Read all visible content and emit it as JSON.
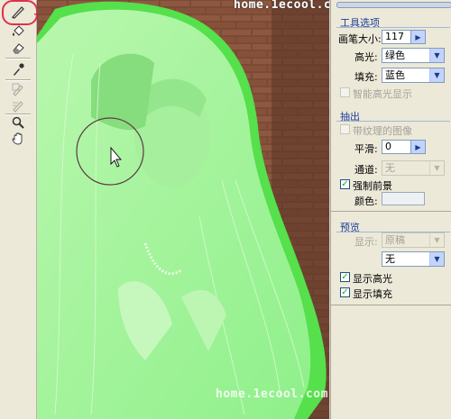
{
  "watermark": "home.1ecool.com",
  "tools": [
    {
      "name": "edge-highlighter-tool-icon",
      "active": true
    },
    {
      "name": "fill-tool-icon"
    },
    {
      "name": "eraser-tool-icon"
    },
    {
      "name": "eyedropper-tool-icon"
    },
    {
      "name": "cleanup-tool-icon",
      "disabled": true
    },
    {
      "name": "edge-touchup-tool-icon",
      "disabled": true
    },
    {
      "name": "zoom-tool-icon"
    },
    {
      "name": "hand-tool-icon"
    }
  ],
  "tool_options": {
    "title": "工具选项",
    "brush_size_label": "画笔大小:",
    "brush_size_value": "117",
    "highlight_label": "高光:",
    "highlight_value": "绿色",
    "fill_label": "填充:",
    "fill_value": "蓝色",
    "smart_highlight_label": "智能高光显示",
    "smart_highlight_checked": false
  },
  "extraction": {
    "title": "抽出",
    "textured_label": "带纹理的图像",
    "textured_checked": false,
    "smooth_label": "平滑:",
    "smooth_value": "0",
    "channel_label": "通道:",
    "channel_value": "无",
    "force_foreground_label": "强制前景",
    "force_foreground_checked": true,
    "color_label": "颜色:"
  },
  "preview": {
    "title": "预览",
    "show_label": "显示:",
    "show_value": "原稿",
    "display_value": "无",
    "show_highlight_label": "显示高光",
    "show_highlight_checked": true,
    "show_fill_label": "显示填充",
    "show_fill_checked": true
  },
  "colors": {
    "overlay_green": "#8cf08a",
    "section_blue": "#1c3d9a",
    "annotation_red": "#e0304c"
  }
}
